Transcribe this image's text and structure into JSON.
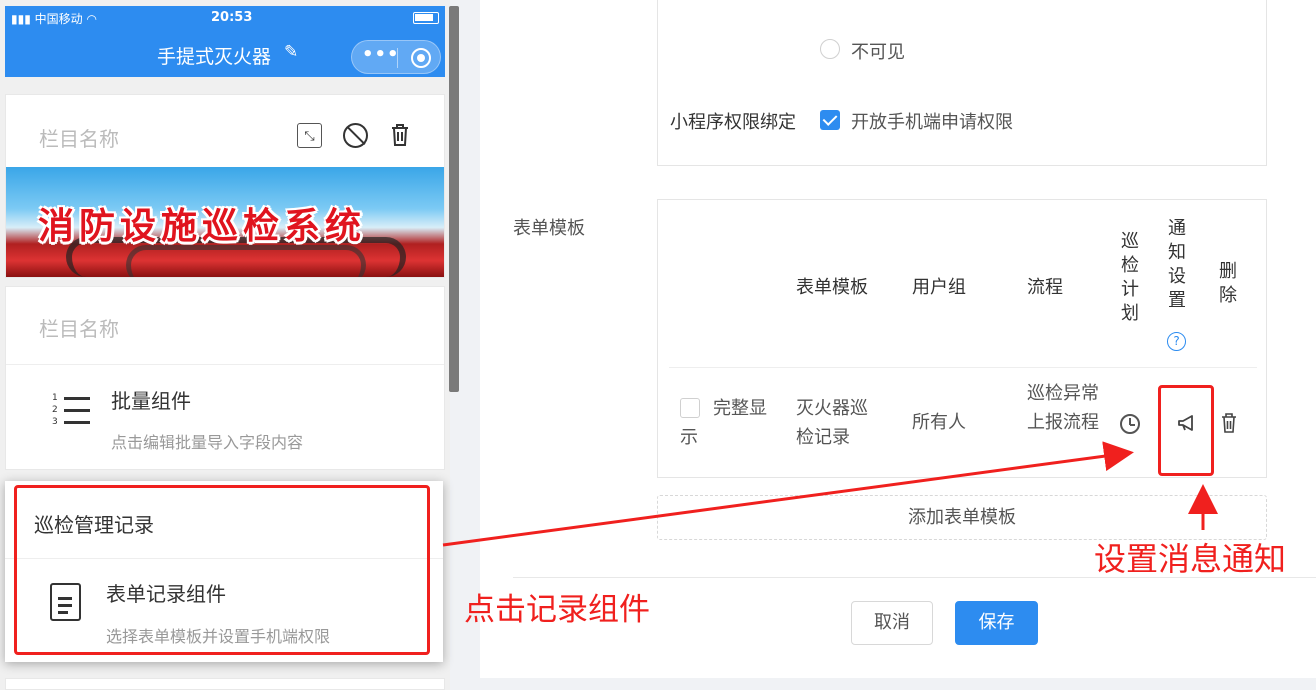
{
  "phone": {
    "status": {
      "carrier": "中国移动",
      "time": "20:53"
    },
    "nav_title": "手提式灭火器",
    "card1": {
      "column_name": "栏目名称",
      "banner_text": "消防设施巡检系统"
    },
    "card2": {
      "column_name": "栏目名称",
      "component_name": "批量组件",
      "component_desc": "点击编辑批量导入字段内容",
      "list_numbers": [
        "1",
        "2",
        "3"
      ]
    },
    "card3": {
      "header": "巡检管理记录",
      "component_name": "表单记录组件",
      "component_desc": "选择表单模板并设置手机端权限"
    }
  },
  "panel": {
    "visibility_option": "不可见",
    "binding_label": "小程序权限绑定",
    "mobile_permission_label": "开放手机端申请权限",
    "mobile_permission_checked": true,
    "form_template_label": "表单模板",
    "table": {
      "headers": {
        "template": "表单模板",
        "user_group": "用户组",
        "flow": "流程",
        "inspection_plan": [
          "巡",
          "检",
          "计",
          "划"
        ],
        "notify_setting": [
          "通",
          "知",
          "设",
          "置"
        ],
        "delete": [
          "删",
          "除"
        ]
      },
      "row": {
        "full_display_label": "完整显示",
        "full_display_checked": false,
        "template": "灭火器巡检记录",
        "user_group": "所有人",
        "flow": "巡检异常上报流程"
      }
    },
    "add_template": "添加表单模板",
    "cancel": "取消",
    "save": "保存"
  },
  "annotations": {
    "click_component": "点击记录组件",
    "set_notification": "设置消息通知",
    "color": "#f0201e"
  },
  "colors": {
    "brand_blue": "#2d8cf0"
  }
}
